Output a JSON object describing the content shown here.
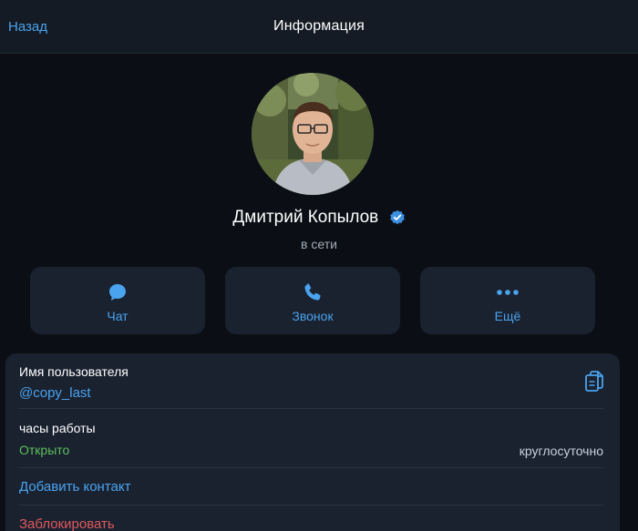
{
  "header": {
    "back_label": "Назад",
    "title": "Информация"
  },
  "profile": {
    "name": "Дмитрий Копылов",
    "status": "в сети",
    "verified": true
  },
  "actions": [
    {
      "label": "Чат",
      "icon": "chat-bubble-icon"
    },
    {
      "label": "Звонок",
      "icon": "phone-icon"
    },
    {
      "label": "Ещё",
      "icon": "more-dots-icon"
    }
  ],
  "info": {
    "username_label": "Имя пользователя",
    "username": "@copy_last",
    "hours_label": "часы работы",
    "hours_status": "Открыто",
    "hours_value": "круглосуточно",
    "add_contact": "Добавить контакт",
    "block": "Заблокировать"
  },
  "colors": {
    "accent": "#4aa3ee",
    "open": "#5fbd5d",
    "danger": "#e0585c",
    "background": "#0b0f15",
    "card": "#1a2230"
  }
}
